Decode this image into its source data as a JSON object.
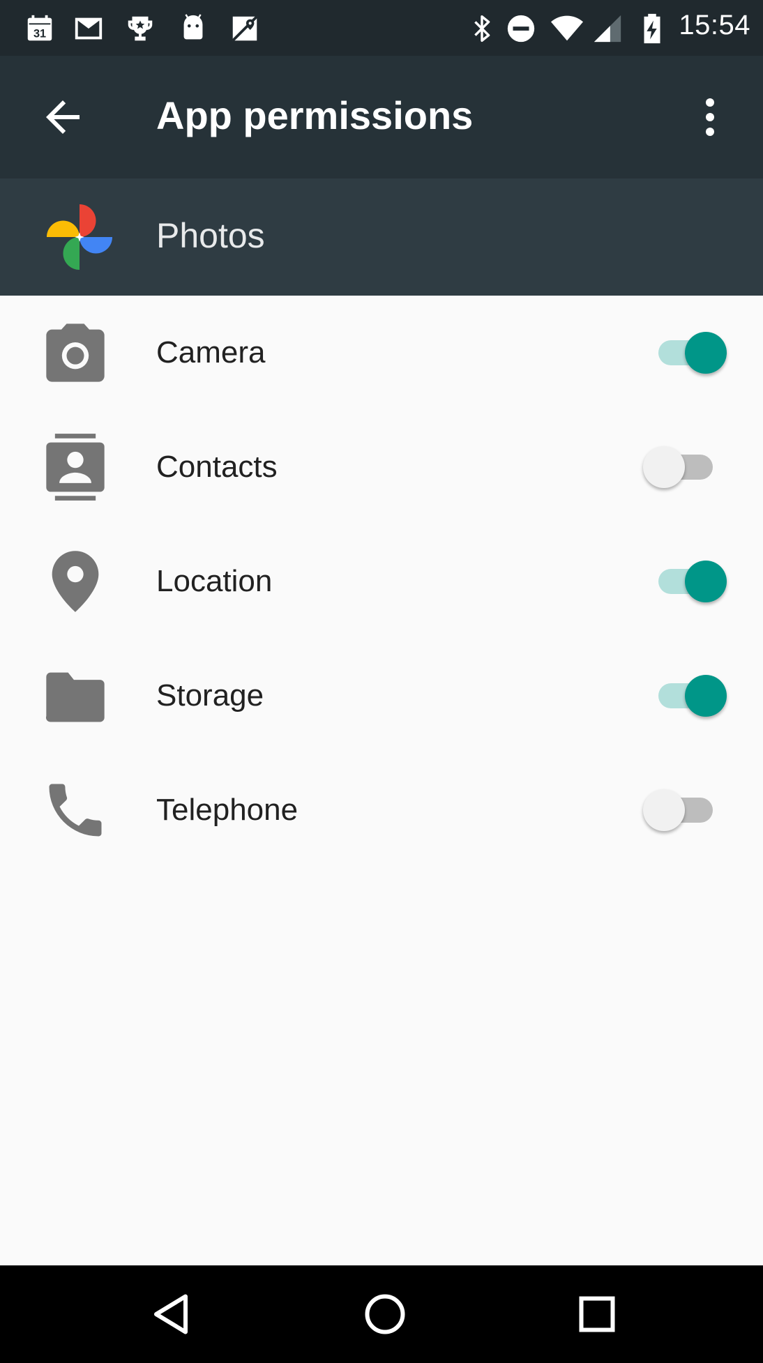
{
  "status_bar": {
    "time": "15:54",
    "calendar_day": "31",
    "notification_icons": [
      "calendar-icon",
      "gmail-icon",
      "trophy-icon",
      "android-icon",
      "maps-icon"
    ],
    "system_icons": [
      "bluetooth-icon",
      "do-not-disturb-icon",
      "wifi-icon",
      "cell-signal-icon",
      "battery-charging-icon"
    ]
  },
  "app_bar": {
    "title": "App permissions",
    "back_icon": "arrow-back-icon",
    "overflow_icon": "more-vert-icon"
  },
  "app_header": {
    "app_name": "Photos",
    "logo_icon": "google-photos-pinwheel-icon"
  },
  "permissions": [
    {
      "label": "Camera",
      "icon": "camera-icon",
      "enabled": true
    },
    {
      "label": "Contacts",
      "icon": "contacts-icon",
      "enabled": false
    },
    {
      "label": "Location",
      "icon": "location-pin-icon",
      "enabled": true
    },
    {
      "label": "Storage",
      "icon": "folder-icon",
      "enabled": true
    },
    {
      "label": "Telephone",
      "icon": "phone-icon",
      "enabled": false
    }
  ],
  "nav_bar": {
    "buttons": [
      "back-triangle-icon",
      "home-circle-icon",
      "recents-square-icon"
    ]
  },
  "colors": {
    "status_bar": "#20292e",
    "app_bar": "#263238",
    "app_header": "#2f3c43",
    "background": "#fafafa",
    "switch_on_thumb": "#009688",
    "switch_on_track": "#b2dfdb",
    "switch_off_thumb": "#f1f1f1",
    "switch_off_track": "#bdbdbd",
    "icon_gray": "#757575"
  }
}
